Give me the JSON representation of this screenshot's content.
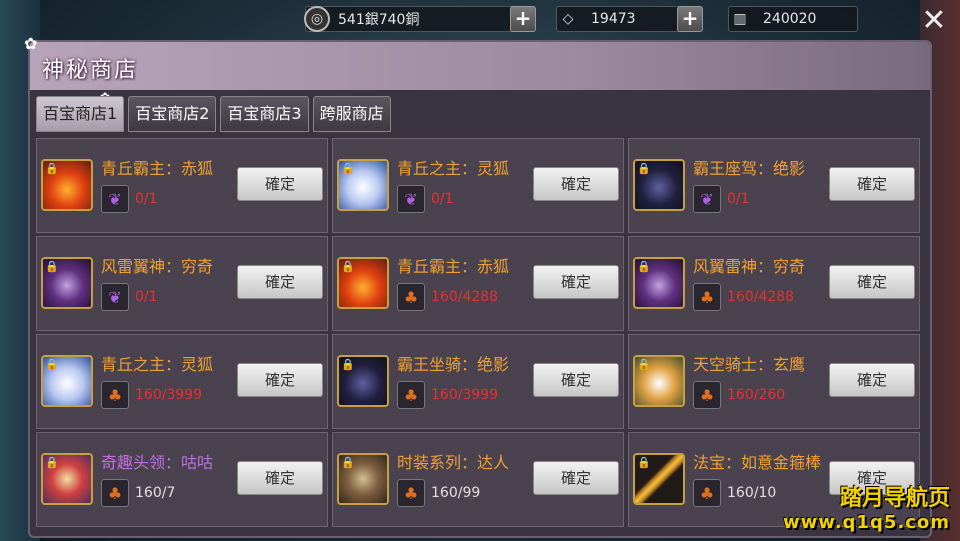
{
  "resources": [
    {
      "icon": "coin-icon",
      "value": "541銀740銅",
      "has_plus": true
    },
    {
      "icon": "diamond-icon",
      "value": "19473",
      "has_plus": true
    },
    {
      "icon": "gold-bars-icon",
      "value": "240020",
      "has_plus": false
    }
  ],
  "title": "神秘商店",
  "tabs": [
    "百宝商店1",
    "百宝商店2",
    "百宝商店3",
    "跨服商店"
  ],
  "active_tab": 0,
  "button_label": "確定",
  "items": [
    {
      "name": "青丘霸主：赤狐",
      "count": "0/1",
      "count_color": "red",
      "item_icon": "purple-crystal-icon",
      "portrait": "red-fox",
      "name_color": "orange"
    },
    {
      "name": "青丘之主：灵狐",
      "count": "0/1",
      "count_color": "red",
      "item_icon": "purple-crystal-icon",
      "portrait": "white-fox",
      "name_color": "orange"
    },
    {
      "name": "霸王座驾：绝影",
      "count": "0/1",
      "count_color": "red",
      "item_icon": "purple-crystal-icon",
      "portrait": "dark-horse",
      "name_color": "orange"
    },
    {
      "name": "风雷翼神：穷奇",
      "count": "0/1",
      "count_color": "red",
      "item_icon": "purple-crystal-icon",
      "portrait": "purple-beast",
      "name_color": "orange"
    },
    {
      "name": "青丘霸主：赤狐",
      "count": "160/4288",
      "count_color": "red",
      "item_icon": "gourd-icon",
      "portrait": "red-fox",
      "name_color": "orange"
    },
    {
      "name": "风翼雷神：穷奇",
      "count": "160/4288",
      "count_color": "red",
      "item_icon": "gourd-icon",
      "portrait": "purple-beast",
      "name_color": "orange"
    },
    {
      "name": "青丘之主：灵狐",
      "count": "160/3999",
      "count_color": "red",
      "item_icon": "gourd-icon",
      "portrait": "white-fox",
      "name_color": "orange"
    },
    {
      "name": "霸王坐骑：绝影",
      "count": "160/3999",
      "count_color": "red",
      "item_icon": "gourd-icon",
      "portrait": "dark-horse",
      "name_color": "orange"
    },
    {
      "name": "天空骑士：玄鹰",
      "count": "160/260",
      "count_color": "red",
      "item_icon": "gourd-icon",
      "portrait": "eagle",
      "name_color": "orange"
    },
    {
      "name": "奇趣头领：咕咕",
      "count": "160/7",
      "count_color": "white",
      "item_icon": "gourd-icon",
      "portrait": "chicken",
      "name_color": "purple"
    },
    {
      "name": "时装系列：达人",
      "count": "160/99",
      "count_color": "white",
      "item_icon": "gourd-icon",
      "portrait": "warrior",
      "name_color": "orange"
    },
    {
      "name": "法宝：如意金箍棒",
      "count": "160/10",
      "count_color": "white",
      "item_icon": "gourd-icon",
      "portrait": "staff",
      "name_color": "orange"
    }
  ],
  "watermark": {
    "line1": "踏月导航页",
    "line2": "www.q1q5.com"
  }
}
